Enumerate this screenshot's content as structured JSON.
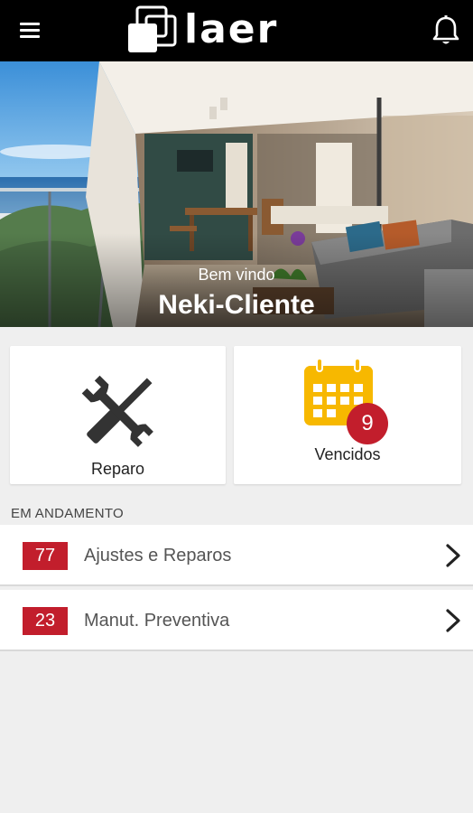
{
  "header": {
    "brand": "laer",
    "menu_icon": "menu-icon",
    "notification_icon": "bell-icon"
  },
  "hero": {
    "welcome": "Bem vindo",
    "user_name": "Neki-Cliente"
  },
  "cards": [
    {
      "label": "Reparo",
      "icon": "tools-icon"
    },
    {
      "label": "Vencidos",
      "icon": "calendar-icon",
      "badge": "9"
    }
  ],
  "section": {
    "title": "EM ANDAMENTO"
  },
  "items": [
    {
      "count": "77",
      "label": "Ajustes e Reparos"
    },
    {
      "count": "23",
      "label": "Manut. Preventiva"
    }
  ],
  "colors": {
    "topbar": "#000000",
    "accent_red": "#c21e2c",
    "calendar_yellow": "#f7b800",
    "background": "#efefef"
  }
}
